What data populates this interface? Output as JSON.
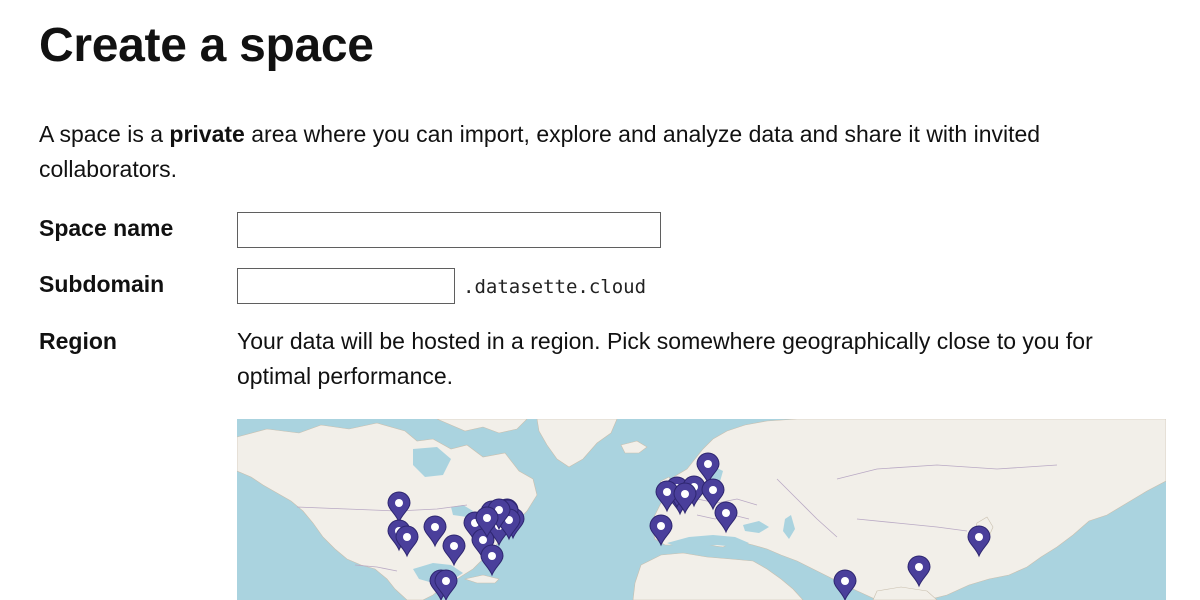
{
  "page": {
    "title": "Create a space",
    "intro_prefix": "A space is a ",
    "intro_bold": "private",
    "intro_suffix": " area where you can import, explore and analyze data and share it with invited collaborators."
  },
  "form": {
    "space_name": {
      "label": "Space name",
      "value": "",
      "placeholder": ""
    },
    "subdomain": {
      "label": "Subdomain",
      "value": "",
      "placeholder": "",
      "suffix": ".datasette.cloud"
    },
    "region": {
      "label": "Region",
      "help": "Your data will be hosted in a region. Pick somewhere geographically close to you for optimal performance."
    }
  },
  "map": {
    "colors": {
      "water": "#aad3df",
      "land": "#f2efe9",
      "border": "#b9a9c4",
      "marker": "#4a3f9b",
      "marker_outline": "#2e2670",
      "marker_dot": "#ffffff"
    },
    "markers": [
      "region-marker-1",
      "region-marker-2",
      "region-marker-3",
      "region-marker-4",
      "region-marker-5",
      "region-marker-6",
      "region-marker-7",
      "region-marker-8",
      "region-marker-9",
      "region-marker-10",
      "region-marker-11",
      "region-marker-12",
      "region-marker-13",
      "region-marker-14",
      "region-marker-15",
      "region-marker-16",
      "region-marker-17",
      "region-marker-18",
      "region-marker-19",
      "region-marker-20",
      "region-marker-21",
      "region-marker-22",
      "region-marker-23",
      "region-marker-24",
      "region-marker-25",
      "region-marker-26",
      "region-marker-27",
      "region-marker-28",
      "region-marker-29",
      "region-marker-30",
      "region-marker-31",
      "region-marker-32"
    ]
  }
}
